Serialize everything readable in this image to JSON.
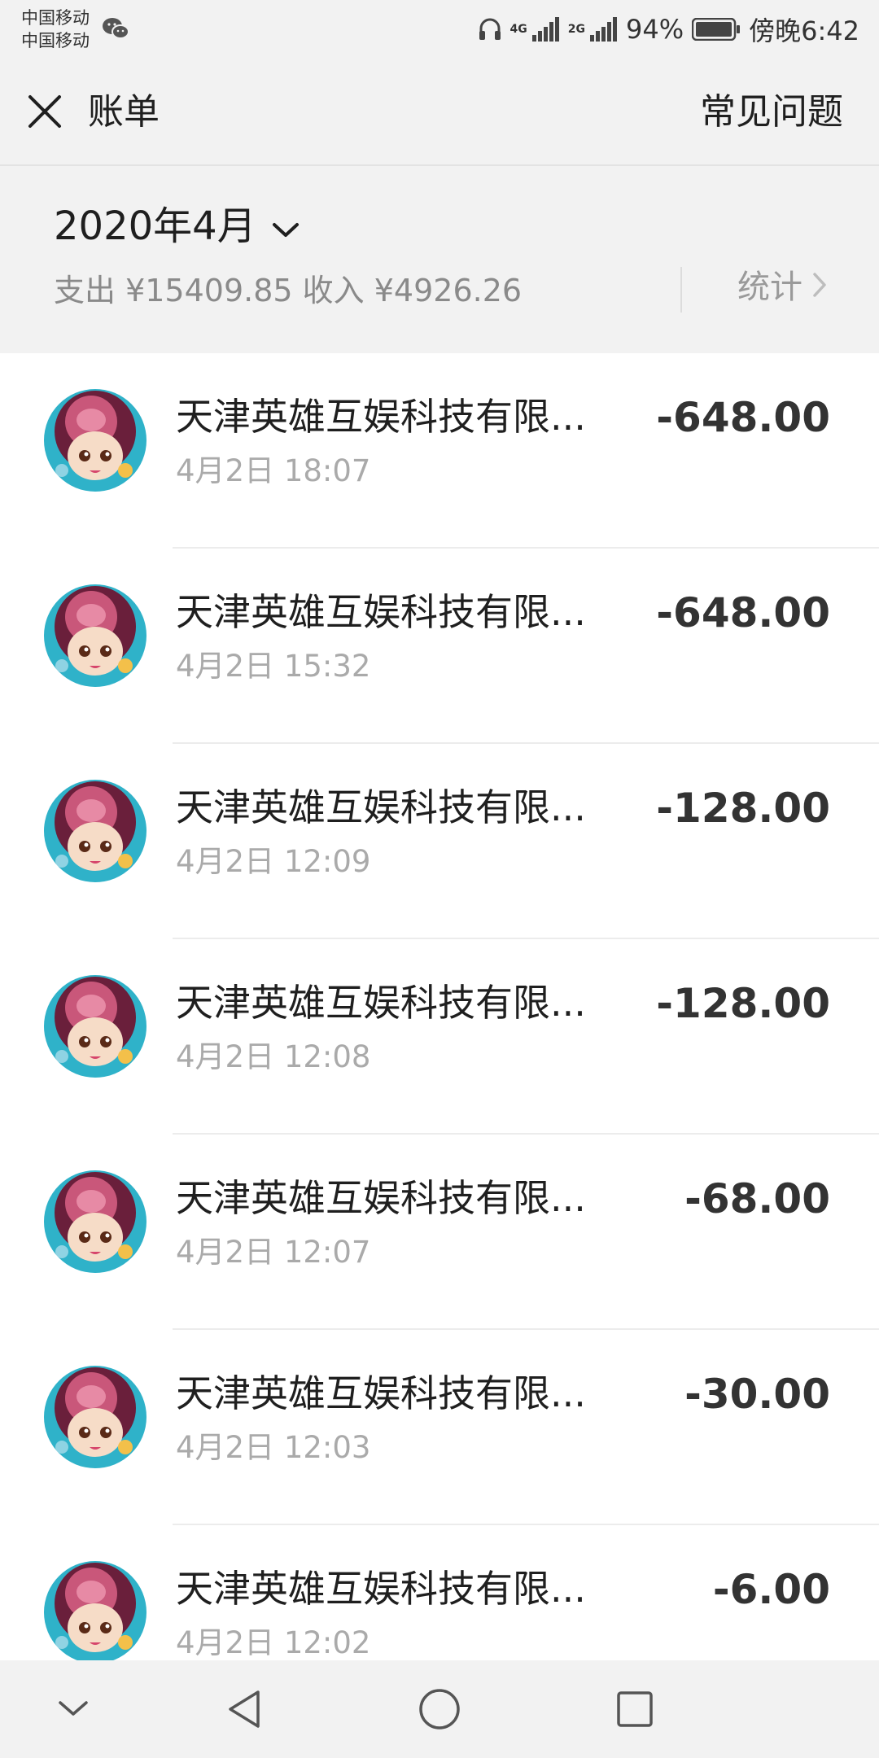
{
  "status_bar": {
    "carrier_1": "中国移动",
    "carrier_2": "中国移动",
    "battery": "94%",
    "time": "傍晚6:42",
    "net_1": "4G",
    "net_2": "2G"
  },
  "header": {
    "title": "账单",
    "faq": "常见问题"
  },
  "summary": {
    "month": "2020年4月",
    "totals": "支出 ¥15409.85 收入 ¥4926.26",
    "stats_label": "统计"
  },
  "transactions": [
    {
      "merchant": "天津英雄互娱科技有限...",
      "datetime": "4月2日 18:07",
      "amount": "-648.00"
    },
    {
      "merchant": "天津英雄互娱科技有限...",
      "datetime": "4月2日 15:32",
      "amount": "-648.00"
    },
    {
      "merchant": "天津英雄互娱科技有限...",
      "datetime": "4月2日 12:09",
      "amount": "-128.00"
    },
    {
      "merchant": "天津英雄互娱科技有限...",
      "datetime": "4月2日 12:08",
      "amount": "-128.00"
    },
    {
      "merchant": "天津英雄互娱科技有限...",
      "datetime": "4月2日 12:07",
      "amount": "-68.00"
    },
    {
      "merchant": "天津英雄互娱科技有限...",
      "datetime": "4月2日 12:03",
      "amount": "-30.00"
    },
    {
      "merchant": "天津英雄互娱科技有限...",
      "datetime": "4月2日 12:02",
      "amount": "-6.00"
    }
  ],
  "icons": {
    "close": "close-icon",
    "dropdown": "chevron-down-icon",
    "stats_arrow": "chevron-right-icon",
    "avatar": "cartoon-girl-avatar",
    "nav_collapse": "chevron-down-icon",
    "nav_back": "triangle-back-icon",
    "nav_home": "circle-home-icon",
    "nav_recent": "square-recent-icon"
  },
  "colors": {
    "background": "#f2f2f2",
    "text_primary": "#1f1f1f",
    "text_secondary": "#aaaaaa",
    "amount": "#333333"
  }
}
